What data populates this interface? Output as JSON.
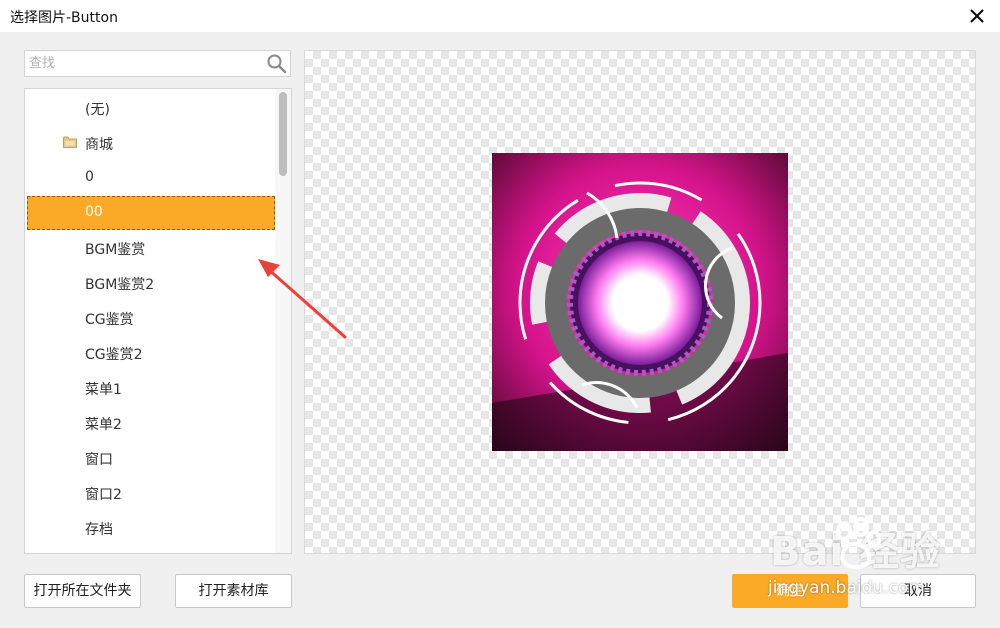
{
  "window": {
    "title": "选择图片-Button"
  },
  "search": {
    "placeholder": "查找",
    "value": "",
    "icon": "search-icon"
  },
  "list": {
    "items": [
      {
        "label": "(无)",
        "icon": ""
      },
      {
        "label": "商城",
        "icon": "folder-icon"
      },
      {
        "label": "0",
        "icon": ""
      },
      {
        "label": "00",
        "icon": "",
        "selected": true
      },
      {
        "label": "BGM鉴赏",
        "icon": ""
      },
      {
        "label": "BGM鉴赏2",
        "icon": ""
      },
      {
        "label": "CG鉴赏",
        "icon": ""
      },
      {
        "label": "CG鉴赏2",
        "icon": ""
      },
      {
        "label": "菜单1",
        "icon": ""
      },
      {
        "label": "菜单2",
        "icon": ""
      },
      {
        "label": "窗口",
        "icon": ""
      },
      {
        "label": "窗口2",
        "icon": ""
      },
      {
        "label": "存档",
        "icon": ""
      }
    ]
  },
  "buttons": {
    "open_folder": "打开所在文件夹",
    "open_library": "打开素材库",
    "ok": "确定",
    "cancel": "取消"
  },
  "watermark": {
    "brand": "Bai  经验",
    "url": "jingyan.baidu.com"
  },
  "colors": {
    "accent": "#fbaa28",
    "selection_text": "#ffffff",
    "arrow": "#e8433b"
  }
}
